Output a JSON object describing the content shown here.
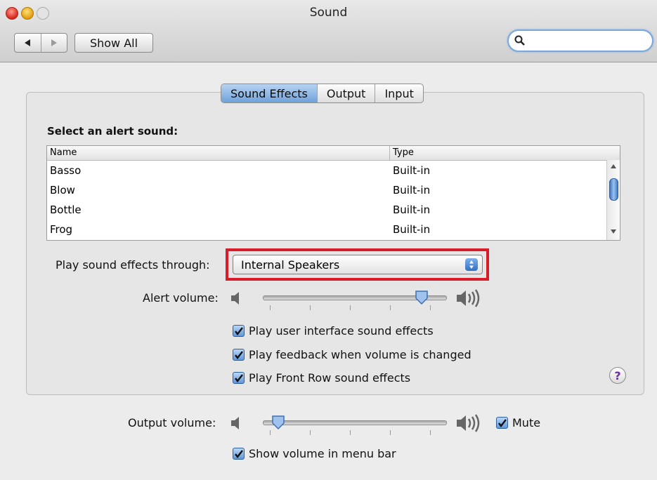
{
  "window": {
    "title": "Sound"
  },
  "toolbar": {
    "show_all_label": "Show All",
    "search_placeholder": ""
  },
  "tabs": [
    {
      "label": "Sound Effects",
      "active": true
    },
    {
      "label": "Output",
      "active": false
    },
    {
      "label": "Input",
      "active": false
    }
  ],
  "sound_effects": {
    "heading": "Select an alert sound:",
    "columns": [
      "Name",
      "Type"
    ],
    "rows": [
      {
        "name": "Basso",
        "type": "Built-in"
      },
      {
        "name": "Blow",
        "type": "Built-in"
      },
      {
        "name": "Bottle",
        "type": "Built-in"
      },
      {
        "name": "Frog",
        "type": "Built-in"
      }
    ],
    "play_through_label": "Play sound effects through:",
    "play_through_value": "Internal Speakers",
    "alert_volume_label": "Alert volume:",
    "alert_volume_level": 0.9,
    "checkboxes": [
      {
        "label": "Play user interface sound effects",
        "checked": true
      },
      {
        "label": "Play feedback when volume is changed",
        "checked": true
      },
      {
        "label": "Play Front Row sound effects",
        "checked": true
      }
    ],
    "help_label": "?"
  },
  "output": {
    "volume_label": "Output volume:",
    "volume_level": 0.05,
    "mute_label": "Mute",
    "mute_checked": true,
    "show_in_menubar_label": "Show volume in menu bar",
    "show_in_menubar_checked": true
  },
  "highlight_color": "#d91c2a",
  "accent_color": "#6fa2dc"
}
